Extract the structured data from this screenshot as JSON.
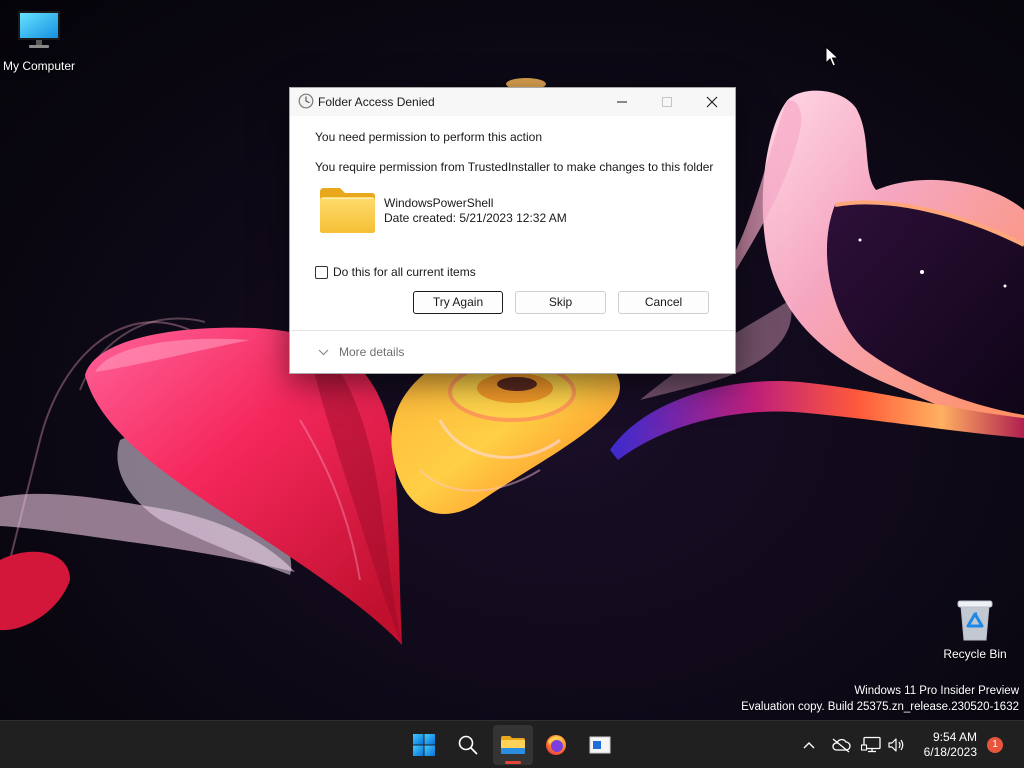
{
  "desktop": {
    "icons": [
      {
        "label": "My Computer",
        "icon": "monitor-icon"
      },
      {
        "label": "Recycle Bin",
        "icon": "recycle-bin-icon"
      }
    ],
    "watermark": {
      "edition": "Windows 11 Pro Insider Preview",
      "build": "Evaluation copy. Build 25375.zn_release.230520-1632"
    }
  },
  "dialog": {
    "title": "Folder Access Denied",
    "title_icon": "clock-icon",
    "window_controls": {
      "minimize": "minimize-icon",
      "maximize": "maximize-icon",
      "close": "close-icon",
      "maximize_enabled": false
    },
    "heading": "You need permission to perform this action",
    "message": "You require permission from TrustedInstaller to make changes to this folder",
    "item": {
      "icon": "folder-icon",
      "name": "WindowsPowerShell",
      "date_created": "Date created: 5/21/2023 12:32 AM"
    },
    "apply_to_all": {
      "label": "Do this for all current items",
      "checked": false
    },
    "buttons": {
      "try_again": "Try Again",
      "skip": "Skip",
      "cancel": "Cancel"
    },
    "more_details": {
      "label": "More details",
      "icon": "chevron-down-icon",
      "expanded": false
    }
  },
  "taskbar": {
    "pinned": [
      {
        "icon": "windows-start-icon",
        "active": false
      },
      {
        "icon": "search-icon",
        "active": false
      },
      {
        "icon": "file-explorer-icon",
        "active": true
      },
      {
        "icon": "firefox-icon",
        "active": false
      },
      {
        "icon": "app-window-icon",
        "active": false
      }
    ],
    "tray": {
      "icons": [
        "chevron-up-icon",
        "cloud-offline-icon",
        "ethernet-icon",
        "volume-icon"
      ],
      "time": "9:54 AM",
      "date": "6/18/2023",
      "notification_count": 1
    }
  },
  "colors": {
    "titlebar_bg": "#f7f7f7",
    "focus_border": "#1b1b1b",
    "button_border": "#d0d0d0",
    "active_indicator": "#e0473a",
    "notification_badge": "#e8553d",
    "taskbar_bg": "#202020"
  }
}
